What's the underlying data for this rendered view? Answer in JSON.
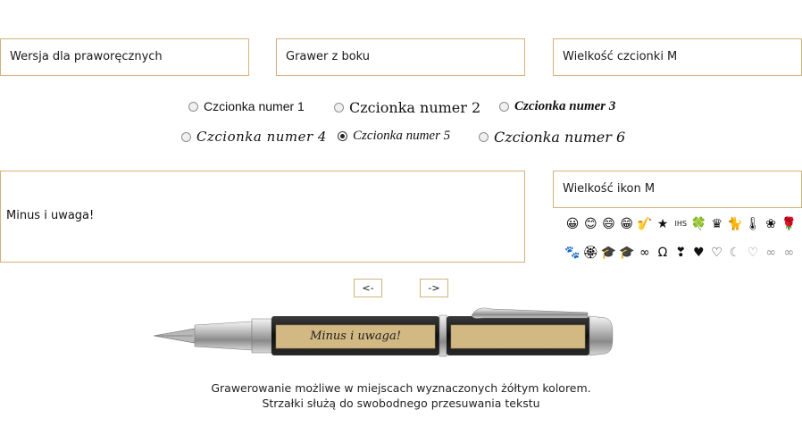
{
  "selects": {
    "hand": "Wersja dla praworęcznych",
    "position": "Grawer z boku",
    "font_size": "Wielkość czcionki M",
    "icon_size": "Wielkość ikon M"
  },
  "fonts": [
    {
      "label": "Czcionka numer 1",
      "selected": false
    },
    {
      "label": "Czcionka numer 2",
      "selected": false
    },
    {
      "label": "Czcionka numer 3",
      "selected": false
    },
    {
      "label": "Czcionka numer 4",
      "selected": false
    },
    {
      "label": "Czcionka numer 5",
      "selected": true
    },
    {
      "label": "Czcionka numer 6",
      "selected": false
    }
  ],
  "engraving_text": "Minus i uwaga!",
  "icons_row1": [
    "😀",
    "😊",
    "😄",
    "😁",
    "🎷",
    "★",
    "IHS",
    "🍀",
    "♛",
    "🐈",
    "🌡",
    "❀",
    "🌹"
  ],
  "icons_row2": [
    "🐾",
    "🏵",
    "🎓",
    "🎓",
    "∞",
    "Ω",
    "❣",
    "♥",
    "♡",
    "☾",
    "♡",
    "∞",
    "∞"
  ],
  "arrows": {
    "left": "<-",
    "right": "->"
  },
  "pen_engraving": "Minus i uwaga!",
  "captions": {
    "line1": "Grawerowanie możliwe w miejscach wyznaczonych żółtym kolorem.",
    "line2": "Strzałki służą do swobodnego przesuwania tekstu"
  }
}
